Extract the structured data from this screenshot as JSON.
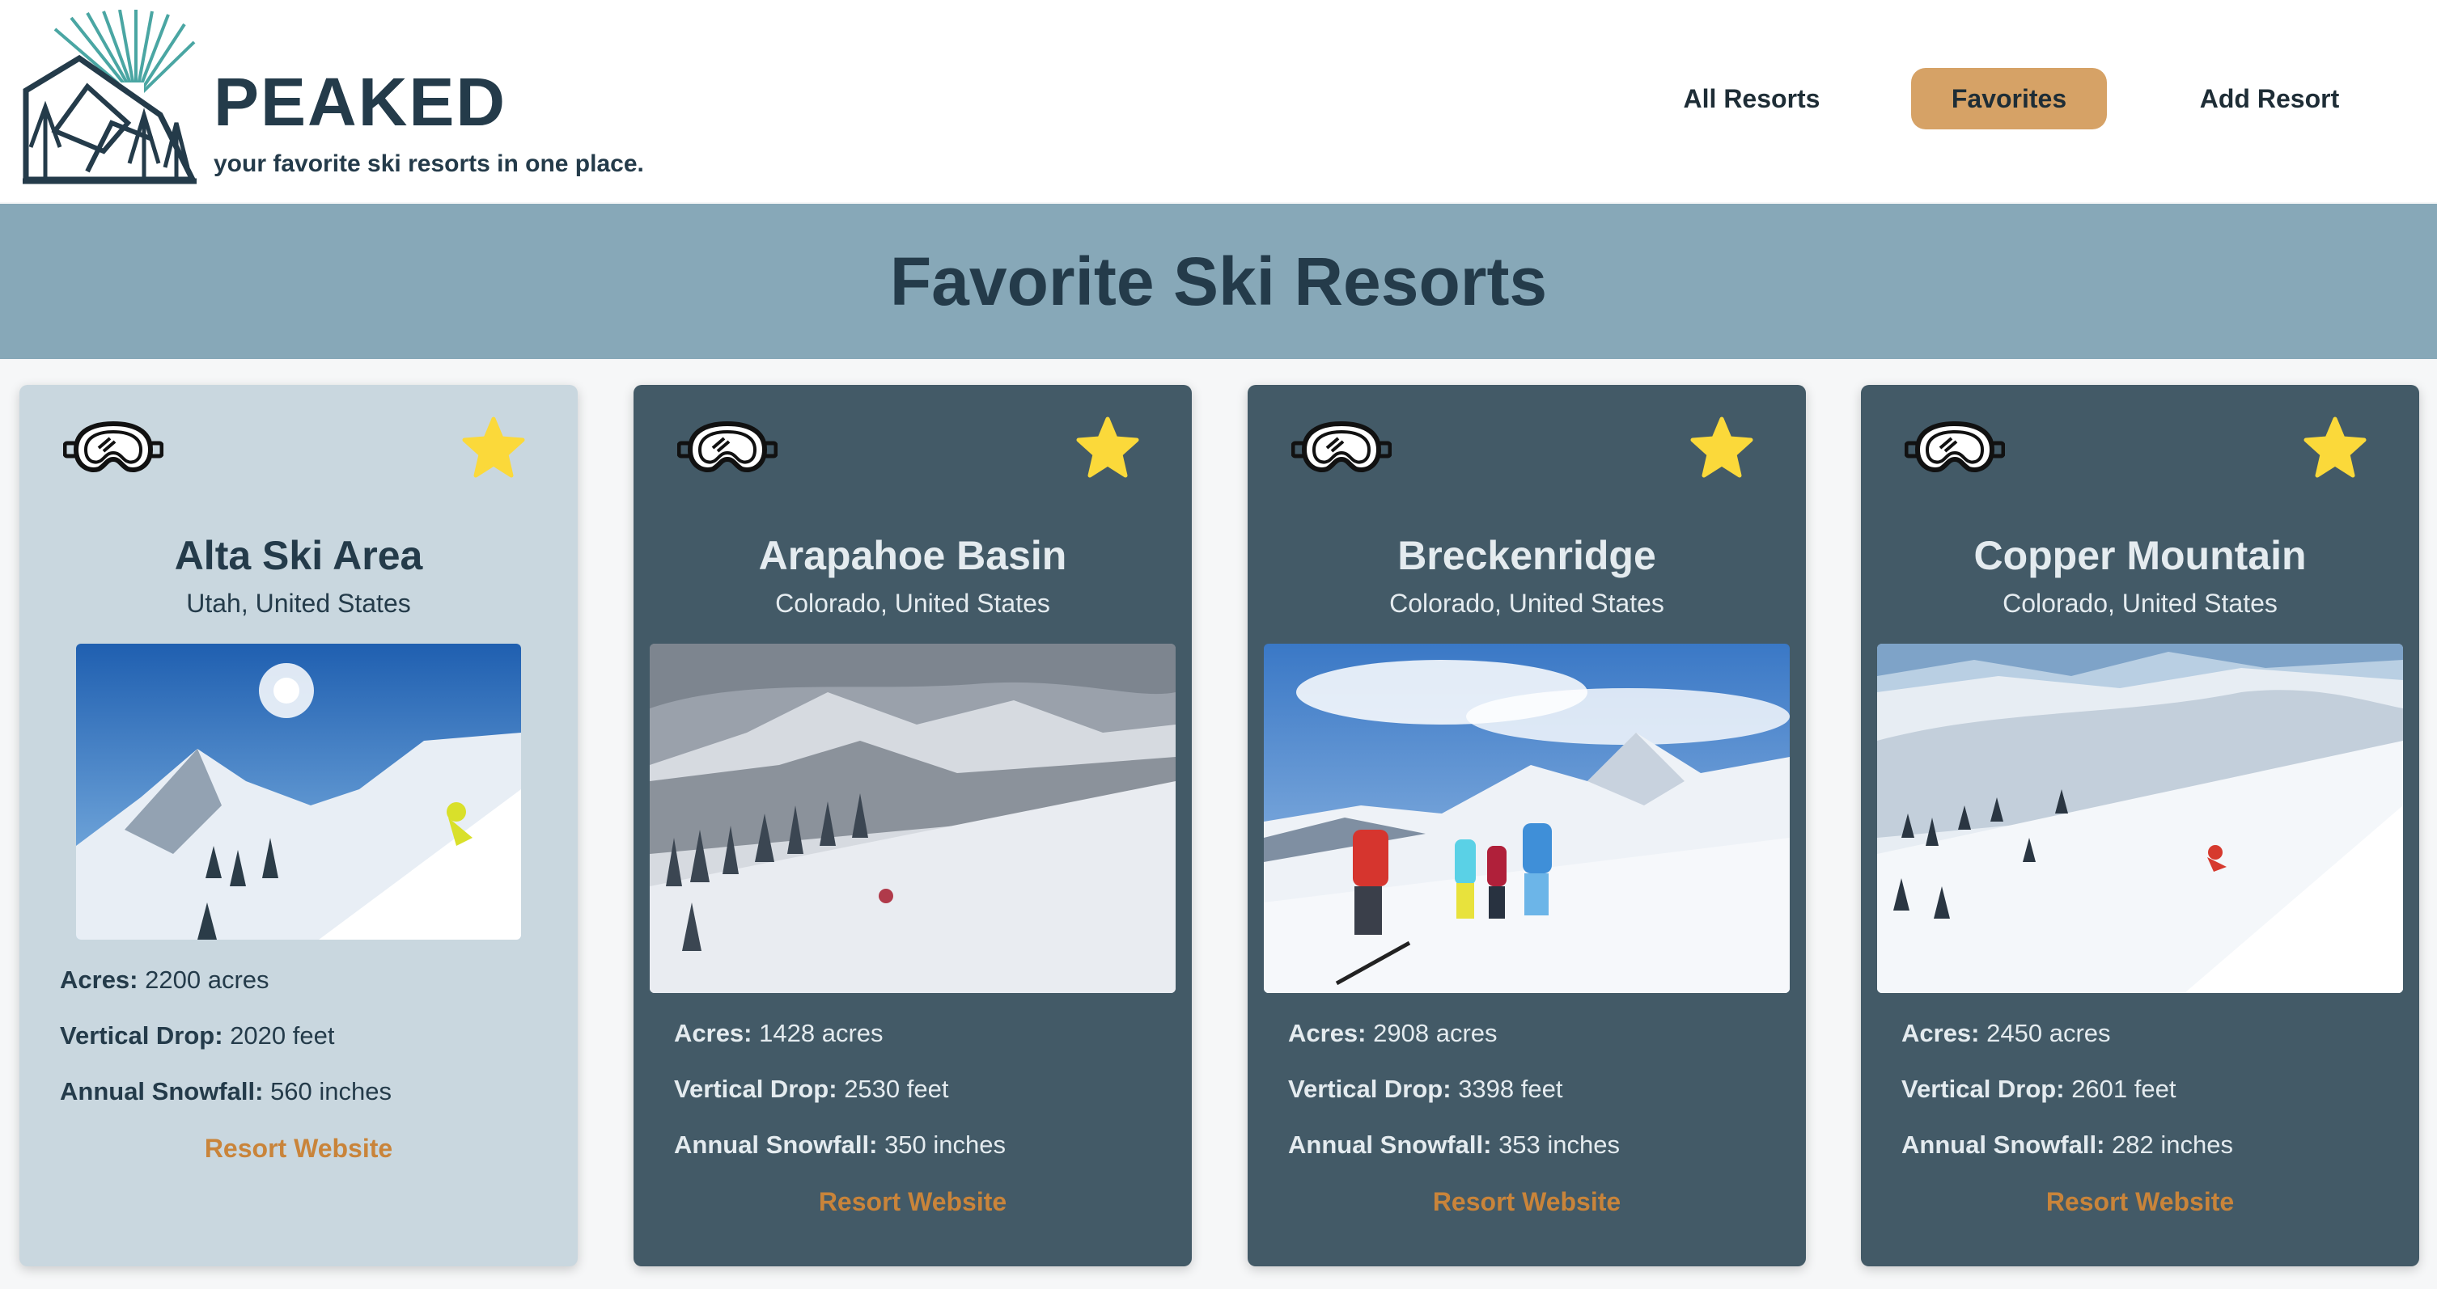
{
  "brand": {
    "name": "PEAKED",
    "tagline": "your favorite ski resorts in one place."
  },
  "nav": {
    "all_resorts": "All Resorts",
    "favorites": "Favorites",
    "add_resort": "Add Resort",
    "active": "Favorites"
  },
  "banner": {
    "title": "Favorite Ski Resorts"
  },
  "labels": {
    "acres": "Acres:",
    "vertical_drop": "Vertical Drop:",
    "annual_snowfall": "Annual Snowfall:",
    "website": "Resort Website"
  },
  "colors": {
    "accent": "#d6a266",
    "link": "#c9843a",
    "banner": "#87a8b8",
    "card_dark": "#435a67",
    "card_light": "#c9d7df",
    "star": "#fbd93a"
  },
  "resorts": [
    {
      "name": "Alta Ski Area",
      "location": "Utah, United States",
      "acres": "2200 acres",
      "vertical_drop": "2020 feet",
      "annual_snowfall": "560 inches",
      "favorite_icon": "star-icon"
    },
    {
      "name": "Arapahoe Basin",
      "location": "Colorado, United States",
      "acres": "1428 acres",
      "vertical_drop": "2530 feet",
      "annual_snowfall": "350 inches",
      "favorite_icon": "star-icon"
    },
    {
      "name": "Breckenridge",
      "location": "Colorado, United States",
      "acres": "2908 acres",
      "vertical_drop": "3398 feet",
      "annual_snowfall": "353 inches",
      "favorite_icon": "star-icon"
    },
    {
      "name": "Copper Mountain",
      "location": "Colorado, United States",
      "acres": "2450 acres",
      "vertical_drop": "2601 feet",
      "annual_snowfall": "282 inches",
      "favorite_icon": "star-icon"
    }
  ]
}
